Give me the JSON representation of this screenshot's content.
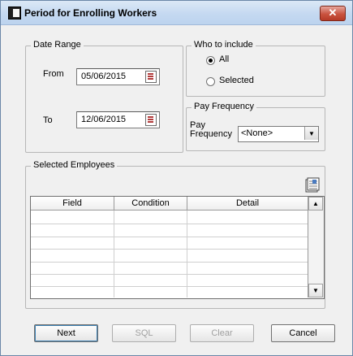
{
  "window": {
    "title": "Period for Enrolling Workers",
    "close_glyph": "✕"
  },
  "date_range": {
    "legend": "Date Range",
    "from_label": "From",
    "from_value": "05/06/2015",
    "to_label": "To",
    "to_value": "12/06/2015"
  },
  "who_to_include": {
    "legend": "Who to include",
    "options": [
      {
        "label": "All",
        "selected": true
      },
      {
        "label": "Selected",
        "selected": false
      }
    ]
  },
  "pay_frequency": {
    "legend": "Pay Frequency",
    "label_line1": "Pay",
    "label_line2": "Frequency",
    "selected": "<None>"
  },
  "selected_employees": {
    "legend": "Selected Employees",
    "columns": [
      "Field",
      "Condition",
      "Detail"
    ]
  },
  "buttons": {
    "next": "Next",
    "sql": "SQL",
    "clear": "Clear",
    "cancel": "Cancel"
  },
  "icons": {
    "app": "app-icon",
    "calendar": "calendar-icon",
    "import": "import-document-icon"
  }
}
